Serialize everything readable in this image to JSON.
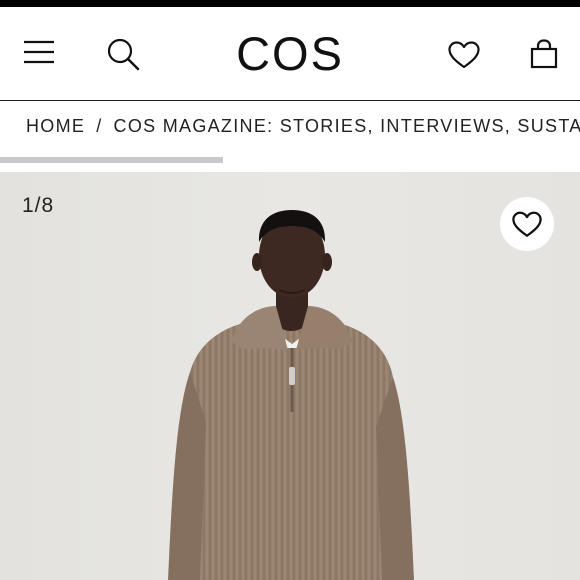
{
  "header": {
    "logo": "COS",
    "icons": {
      "menu": "menu-icon",
      "search": "search-icon",
      "wishlist": "heart-icon",
      "bag": "shopping-bag-icon"
    }
  },
  "breadcrumb": {
    "home": "HOME",
    "separator": "/",
    "current": "COS MAGAZINE: STORIES, INTERVIEWS, SUSTAI"
  },
  "gallery": {
    "counter": "1/8",
    "favorite_icon": "heart-icon",
    "image": "model wearing a brown half-zip knit sweater"
  },
  "colors": {
    "accent": "#000000",
    "hero_background": "#e6e5e1",
    "sweater": "#9a8371"
  }
}
